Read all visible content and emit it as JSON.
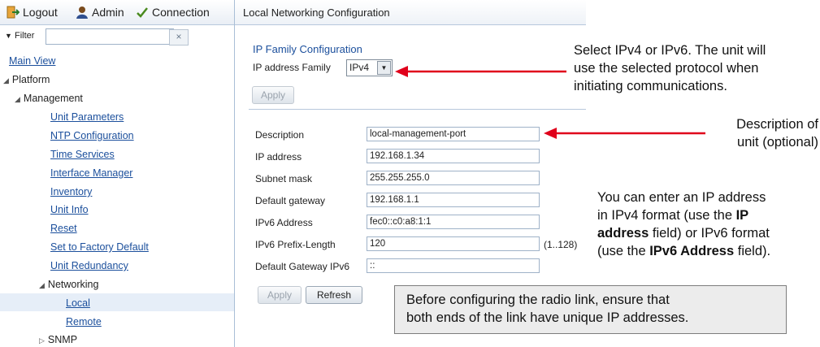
{
  "topbar": {
    "logout_label": "Logout",
    "admin_label": "Admin",
    "connection_label": "Connection"
  },
  "filter": {
    "label": "Filter",
    "value": "",
    "clear_symbol": "×"
  },
  "nav": {
    "main_view": "Main View",
    "platform": "Platform",
    "management": "Management",
    "management_items": [
      "Unit Parameters",
      "NTP Configuration",
      "Time Services",
      "Interface Manager",
      "Inventory",
      "Unit Info",
      "Reset",
      "Set to Factory Default",
      "Unit Redundancy"
    ],
    "networking": "Networking",
    "networking_items": [
      "Local",
      "Remote"
    ],
    "snmp": "SNMP"
  },
  "main": {
    "title": "Local Networking Configuration",
    "ip_family": {
      "section_title": "IP Family Configuration",
      "label": "IP address Family",
      "selected": "IPv4",
      "apply_label": "Apply"
    },
    "form": {
      "description": {
        "label": "Description",
        "value": "local-management-port"
      },
      "ip_address": {
        "label": "IP address",
        "value": "192.168.1.34"
      },
      "subnet_mask": {
        "label": "Subnet mask",
        "value": "255.255.255.0"
      },
      "default_gateway": {
        "label": "Default gateway",
        "value": "192.168.1.1"
      },
      "ipv6_address": {
        "label": "IPv6 Address",
        "value": "fec0::c0:a8:1:1"
      },
      "ipv6_prefix": {
        "label": "IPv6 Prefix-Length",
        "value": "120",
        "range": "(1..128)"
      },
      "default_gateway_ipv6": {
        "label": "Default Gateway IPv6",
        "value": "::"
      },
      "apply_label": "Apply",
      "refresh_label": "Refresh"
    }
  },
  "annotations": {
    "family_note": [
      "Select IPv4 or IPv6. The unit will",
      "use the selected protocol when",
      "initiating communications."
    ],
    "description_note": [
      "Description of",
      "unit (optional)"
    ],
    "ip_note": {
      "l1": "You can enter an IP address",
      "l2a": "in IPv4 format (use the ",
      "l2b": "IP",
      "l3a": "address",
      "l3b": " field) or IPv6 format",
      "l4a": "(use the ",
      "l4b": "IPv6 Address",
      "l4c": " field)."
    },
    "callout": [
      "Before configuring the radio link, ensure that",
      "both ends of the link have unique IP addresses."
    ]
  },
  "colors": {
    "arrow": "#e0001b",
    "link": "#1b4f9c"
  }
}
